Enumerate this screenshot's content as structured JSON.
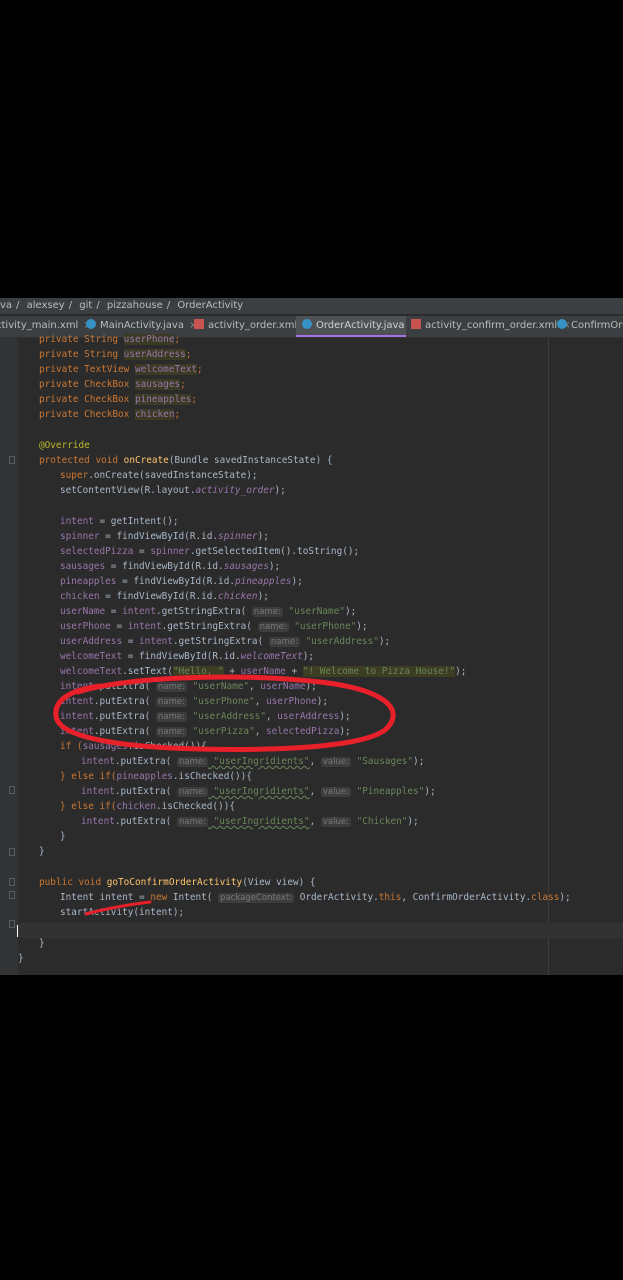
{
  "breadcrumb": [
    "va",
    "alexsey",
    "git",
    "pizzahouse",
    "OrderActivity"
  ],
  "tabs": [
    {
      "label": "ctivity_main.xml",
      "kind": "xml",
      "active": false
    },
    {
      "label": "MainActivity.java",
      "kind": "java",
      "active": false
    },
    {
      "label": "activity_order.xml",
      "kind": "xml",
      "active": false
    },
    {
      "label": "OrderActivity.java",
      "kind": "java",
      "active": true
    },
    {
      "label": "activity_confirm_order.xml",
      "kind": "xml",
      "active": false
    },
    {
      "label": "ConfirmOrde",
      "kind": "java",
      "active": false
    }
  ],
  "code": {
    "l01_a": "private String ",
    "l01_b": "userPhone",
    "l01_c": ";",
    "l02_a": "private String ",
    "l02_b": "userAddress",
    "l02_c": ";",
    "l03_a": "private TextView ",
    "l03_b": "welcomeText",
    "l03_c": ";",
    "l04_a": "private CheckBox ",
    "l04_b": "sausages",
    "l04_c": ";",
    "l05_a": "private CheckBox ",
    "l05_b": "pineapples",
    "l05_c": ";",
    "l06_a": "private CheckBox ",
    "l06_b": "chicken",
    "l06_c": ";",
    "l08": "@Override",
    "l09_a": "protected void ",
    "l09_b": "onCreate",
    "l09_c": "(Bundle savedInstanceState) {",
    "l10_a": "super",
    "l10_b": ".onCreate(savedInstanceState);",
    "l11_a": "setContentView(R.layout.",
    "l11_b": "activity_order",
    "l11_c": ");",
    "l13_a": "intent",
    "l13_b": " = getIntent();",
    "l14_a": "spinner",
    "l14_b": " = findViewById(R.id.",
    "l14_c": "spinner",
    "l14_d": ");",
    "l15_a": "selectedPizza",
    "l15_b": " = ",
    "l15_c": "spinner",
    "l15_d": ".getSelectedItem().toString();",
    "l16_a": "sausages",
    "l16_b": " = findViewById(R.id.",
    "l16_c": "sausages",
    "l16_d": ");",
    "l17_a": "pineapples",
    "l17_b": " = findViewById(R.id.",
    "l17_c": "pineapples",
    "l17_d": ");",
    "l18_a": "chicken",
    "l18_b": " = findViewById(R.id.",
    "l18_c": "chicken",
    "l18_d": ");",
    "l19_a": "userName",
    "l19_b": " = ",
    "l19_c": "intent",
    "l19_d": ".getStringExtra( ",
    "l19_h": "name:",
    "l19_s": " \"userName\"",
    "l19_e": ");",
    "l20_a": "userPhone",
    "l20_b": " = ",
    "l20_c": "intent",
    "l20_d": ".getStringExtra( ",
    "l20_h": "name:",
    "l20_s": " \"userPhone\"",
    "l20_e": ");",
    "l21_a": "userAddress",
    "l21_b": " = ",
    "l21_c": "intent",
    "l21_d": ".getStringExtra( ",
    "l21_h": "name:",
    "l21_s": " \"userAddress\"",
    "l21_e": ");",
    "l22_a": "welcomeText",
    "l22_b": " = findViewById(R.id.",
    "l22_c": "welcomeText",
    "l22_d": ");",
    "l23_a": "welcomeText",
    "l23_b": ".setText(",
    "l23_c": "\"Hello, \"",
    "l23_d": " + ",
    "l23_e": "userName",
    "l23_f": " + ",
    "l23_g": "\"! Welcome to Pizza House!\"",
    "l23_h": ");",
    "l24_a": "intent",
    "l24_b": ".putExtra( ",
    "l24_h": "name:",
    "l24_s": " \"userName\"",
    "l24_c": ", ",
    "l24_d": "userName",
    "l24_e": ");",
    "l25_a": "intent",
    "l25_b": ".putExtra( ",
    "l25_h": "name:",
    "l25_s": " \"userPhone\"",
    "l25_c": ", ",
    "l25_d": "userPhone",
    "l25_e": ");",
    "l26_a": "intent",
    "l26_b": ".putExtra( ",
    "l26_h": "name:",
    "l26_s": " \"userAddress\"",
    "l26_c": ", ",
    "l26_d": "userAddress",
    "l26_e": ");",
    "l27_a": "intent",
    "l27_b": ".putExtra( ",
    "l27_h": "name:",
    "l27_s": " \"userPizza\"",
    "l27_c": ", ",
    "l27_d": "selectedPizza",
    "l27_e": ");",
    "l28_a": "if (",
    "l28_b": "sausages",
    "l28_c": ".isChecked()){",
    "l29_a": "intent",
    "l29_b": ".putExtra( ",
    "l29_h": "name:",
    "l29_s": " \"userIngridients\"",
    "l29_c": ", ",
    "l29_v": "value:",
    "l29_t": " \"Sausages\"",
    "l29_e": ");",
    "l30_a": "} else if(",
    "l30_b": "pineapples",
    "l30_c": ".isChecked()){",
    "l31_a": "intent",
    "l31_b": ".putExtra( ",
    "l31_h": "name:",
    "l31_s": " \"userIngridients\"",
    "l31_c": ", ",
    "l31_v": "value:",
    "l31_t": " \"Pineapples\"",
    "l31_e": ");",
    "l32_a": "} else if(",
    "l32_b": "chicken",
    "l32_c": ".isChecked()){",
    "l33_a": "intent",
    "l33_b": ".putExtra( ",
    "l33_h": "name:",
    "l33_s": " \"userIngridients\"",
    "l33_c": ", ",
    "l33_v": "value:",
    "l33_t": " \"Chicken\"",
    "l33_e": ");",
    "l34": "}",
    "l35": "}",
    "l37_a": "public void ",
    "l37_b": "goToConfirmOrderActivity",
    "l37_c": "(View view) {",
    "l38_a": "Intent intent = ",
    "l38_b": "new ",
    "l38_c": "Intent( ",
    "l38_h": "packageContext:",
    "l38_d": " OrderActivity.",
    "l38_e": "this",
    "l38_f": ", ConfirmOrderActivity.",
    "l38_g": "class",
    "l38_i": ");",
    "l39": "startActivity(intent);",
    "l41": "}",
    "l42": "}"
  },
  "colors": {
    "editor_bg": "#2b2b2b",
    "keyword": "#cc7832",
    "field": "#9876aa",
    "string": "#6a8759",
    "annotation": "#bbb529",
    "active_tab_underline": "#a672e5",
    "markup_red": "#e8202a"
  }
}
